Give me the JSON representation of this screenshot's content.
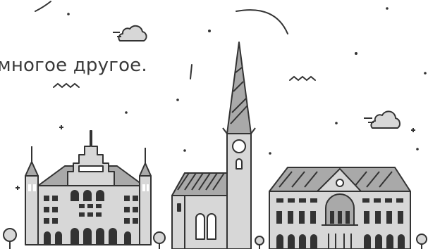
{
  "caption": {
    "text": "многое другое."
  },
  "colors": {
    "stroke": "#333333",
    "fill_light": "#d7d7d7",
    "fill_mid": "#a9a9a9",
    "background": "#ffffff"
  },
  "icons": [
    "cloud-icon",
    "sparkle-icon",
    "wave-icon",
    "tree-icon",
    "town-hall-building",
    "church-building",
    "palace-building"
  ]
}
